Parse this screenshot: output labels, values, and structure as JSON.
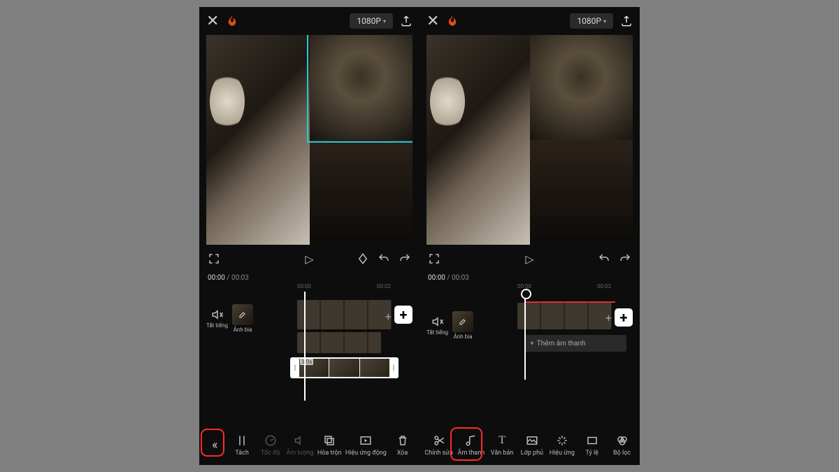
{
  "screens": {
    "left": {
      "topbar": {
        "resolution": "1080P"
      },
      "time": {
        "current": "00:00",
        "total": "00:03"
      },
      "ruler": {
        "marks": [
          "00:00",
          "·",
          "00:02"
        ]
      },
      "mute_label": "Tắt tiếng",
      "cover_label": "Ảnh bìa",
      "selected_clip_duration": "3.0s",
      "tools": [
        {
          "key": "back",
          "label": "",
          "icon": "«"
        },
        {
          "key": "split",
          "label": "Tách",
          "icon": "split"
        },
        {
          "key": "speed",
          "label": "Tốc độ",
          "icon": "speed",
          "dim": true
        },
        {
          "key": "volume",
          "label": "Âm lượng",
          "icon": "volume",
          "dim": true
        },
        {
          "key": "blend",
          "label": "Hòa trộn",
          "icon": "blend"
        },
        {
          "key": "anim",
          "label": "Hiệu ứng động",
          "icon": "anim"
        },
        {
          "key": "delete",
          "label": "Xóa",
          "icon": "trash"
        }
      ],
      "highlight": "back"
    },
    "right": {
      "topbar": {
        "resolution": "1080P"
      },
      "time": {
        "current": "00:00",
        "total": "00:03"
      },
      "ruler": {
        "marks": [
          "00:00",
          "·",
          "00:02"
        ]
      },
      "mute_label": "Tắt tiếng",
      "cover_label": "Ảnh bìa",
      "add_audio_label": "Thêm âm thanh",
      "tools": [
        {
          "key": "edit",
          "label": "Chỉnh sửa",
          "icon": "scissors"
        },
        {
          "key": "audio",
          "label": "Âm thanh",
          "icon": "music"
        },
        {
          "key": "text",
          "label": "Văn bản",
          "icon": "text"
        },
        {
          "key": "overlay",
          "label": "Lớp phủ",
          "icon": "overlay"
        },
        {
          "key": "fx",
          "label": "Hiệu ứng",
          "icon": "sparkle"
        },
        {
          "key": "ratio",
          "label": "Tỷ lệ",
          "icon": "ratio"
        },
        {
          "key": "filter",
          "label": "Bộ lọc",
          "icon": "filter"
        }
      ],
      "highlight": "audio"
    }
  }
}
